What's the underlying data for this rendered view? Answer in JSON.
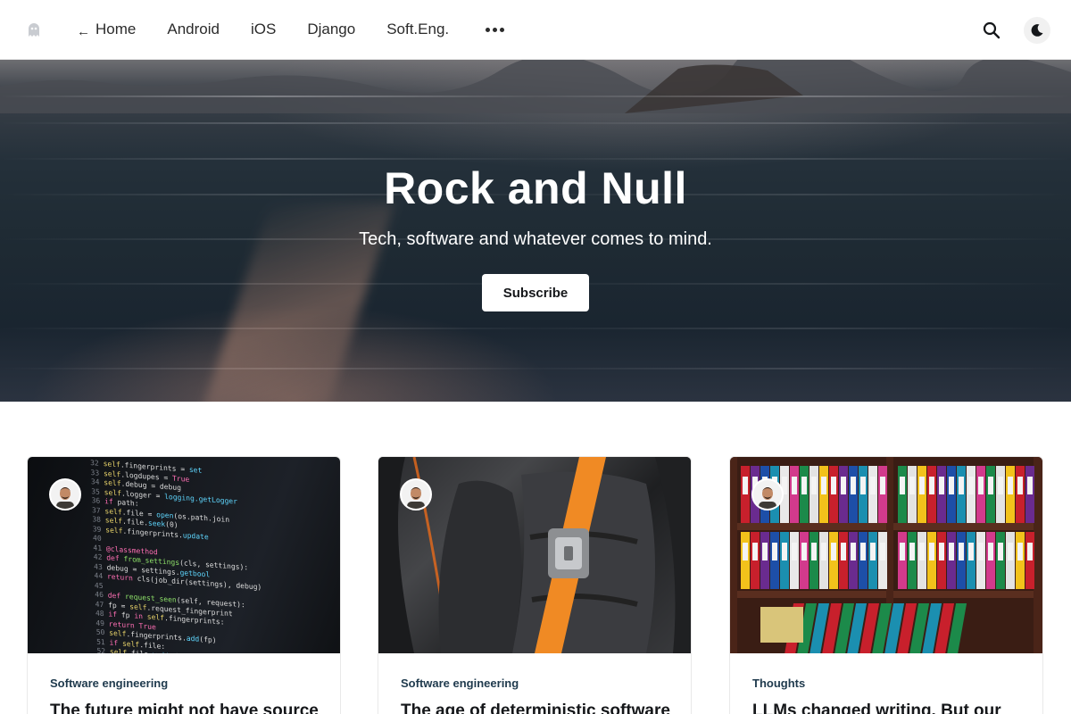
{
  "header": {
    "logo_icon": "ghost-logo-icon",
    "nav": [
      {
        "label": "Home",
        "icon": "left-arrow-icon"
      },
      {
        "label": "Android"
      },
      {
        "label": "iOS"
      },
      {
        "label": "Django"
      },
      {
        "label": "Soft.Eng."
      }
    ],
    "more_icon": "more-dots-icon",
    "search_icon": "search-icon",
    "theme_icon": "moon-icon"
  },
  "hero": {
    "title": "Rock and Null",
    "subtitle": "Tech, software and whatever comes to mind.",
    "subscribe_label": "Subscribe"
  },
  "posts": [
    {
      "tag": "Software engineering",
      "title": "The future might not have source",
      "image": "code-on-screen"
    },
    {
      "tag": "Software engineering",
      "title": "The age of deterministic software",
      "image": "car-seat-belt"
    },
    {
      "tag": "Thoughts",
      "title": "LLMs changed writing. But our",
      "image": "binder-shelf"
    }
  ],
  "colors": {
    "accent": "#1f3a4d",
    "text": "#15171a",
    "header_bg": "#ffffff",
    "subscribe_bg": "#ffffff"
  }
}
